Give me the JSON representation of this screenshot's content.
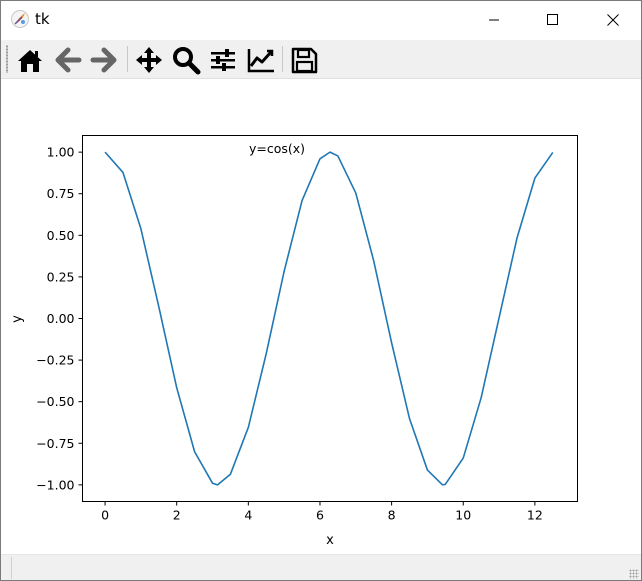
{
  "window": {
    "title": "tk",
    "controls": {
      "minimize": "minimize",
      "maximize": "maximize",
      "close": "close"
    }
  },
  "toolbar": {
    "buttons": [
      {
        "icon": "home-icon",
        "label": "Home"
      },
      {
        "icon": "arrow-left-icon",
        "label": "Back"
      },
      {
        "icon": "arrow-right-icon",
        "label": "Forward"
      },
      {
        "icon": "move-icon",
        "label": "Pan"
      },
      {
        "icon": "magnifier-icon",
        "label": "Zoom"
      },
      {
        "icon": "sliders-icon",
        "label": "Subplots"
      },
      {
        "icon": "chart-line-icon",
        "label": "Customize"
      },
      {
        "icon": "floppy-disk-icon",
        "label": "Save"
      }
    ]
  },
  "status": {
    "message": ""
  },
  "chart_data": {
    "type": "line",
    "title": "",
    "annotation": "y=cos(x)",
    "xlabel": "x",
    "ylabel": "y",
    "xlim": [
      -0.63,
      13.19
    ],
    "ylim": [
      -1.1,
      1.1
    ],
    "xticks": [
      0,
      2,
      4,
      6,
      8,
      10,
      12
    ],
    "xtick_labels": [
      "0",
      "2",
      "4",
      "6",
      "8",
      "10",
      "12"
    ],
    "yticks": [
      1.0,
      0.75,
      0.5,
      0.25,
      0.0,
      -0.25,
      -0.5,
      -0.75,
      -1.0
    ],
    "ytick_labels": [
      "1.00",
      "0.75",
      "0.50",
      "0.25",
      "0.00",
      "−0.25",
      "−0.50",
      "−0.75",
      "−1.00"
    ],
    "grid": false,
    "series": [
      {
        "color": "#1f77b4",
        "x": [
          0.0,
          0.5,
          1.0,
          1.5,
          2.0,
          2.5,
          3.0,
          3.14,
          3.5,
          4.0,
          4.5,
          5.0,
          5.5,
          6.0,
          6.28,
          6.5,
          7.0,
          7.5,
          8.0,
          8.5,
          9.0,
          9.42,
          9.5,
          10.0,
          10.5,
          11.0,
          11.5,
          12.0,
          12.5
        ],
        "y": [
          1.0,
          0.878,
          0.54,
          0.071,
          -0.416,
          -0.801,
          -0.99,
          -1.0,
          -0.936,
          -0.654,
          -0.211,
          0.284,
          0.709,
          0.96,
          1.0,
          0.977,
          0.754,
          0.347,
          -0.146,
          -0.602,
          -0.911,
          -1.0,
          -0.997,
          -0.839,
          -0.476,
          0.004,
          0.483,
          0.844,
          0.998
        ]
      }
    ]
  }
}
